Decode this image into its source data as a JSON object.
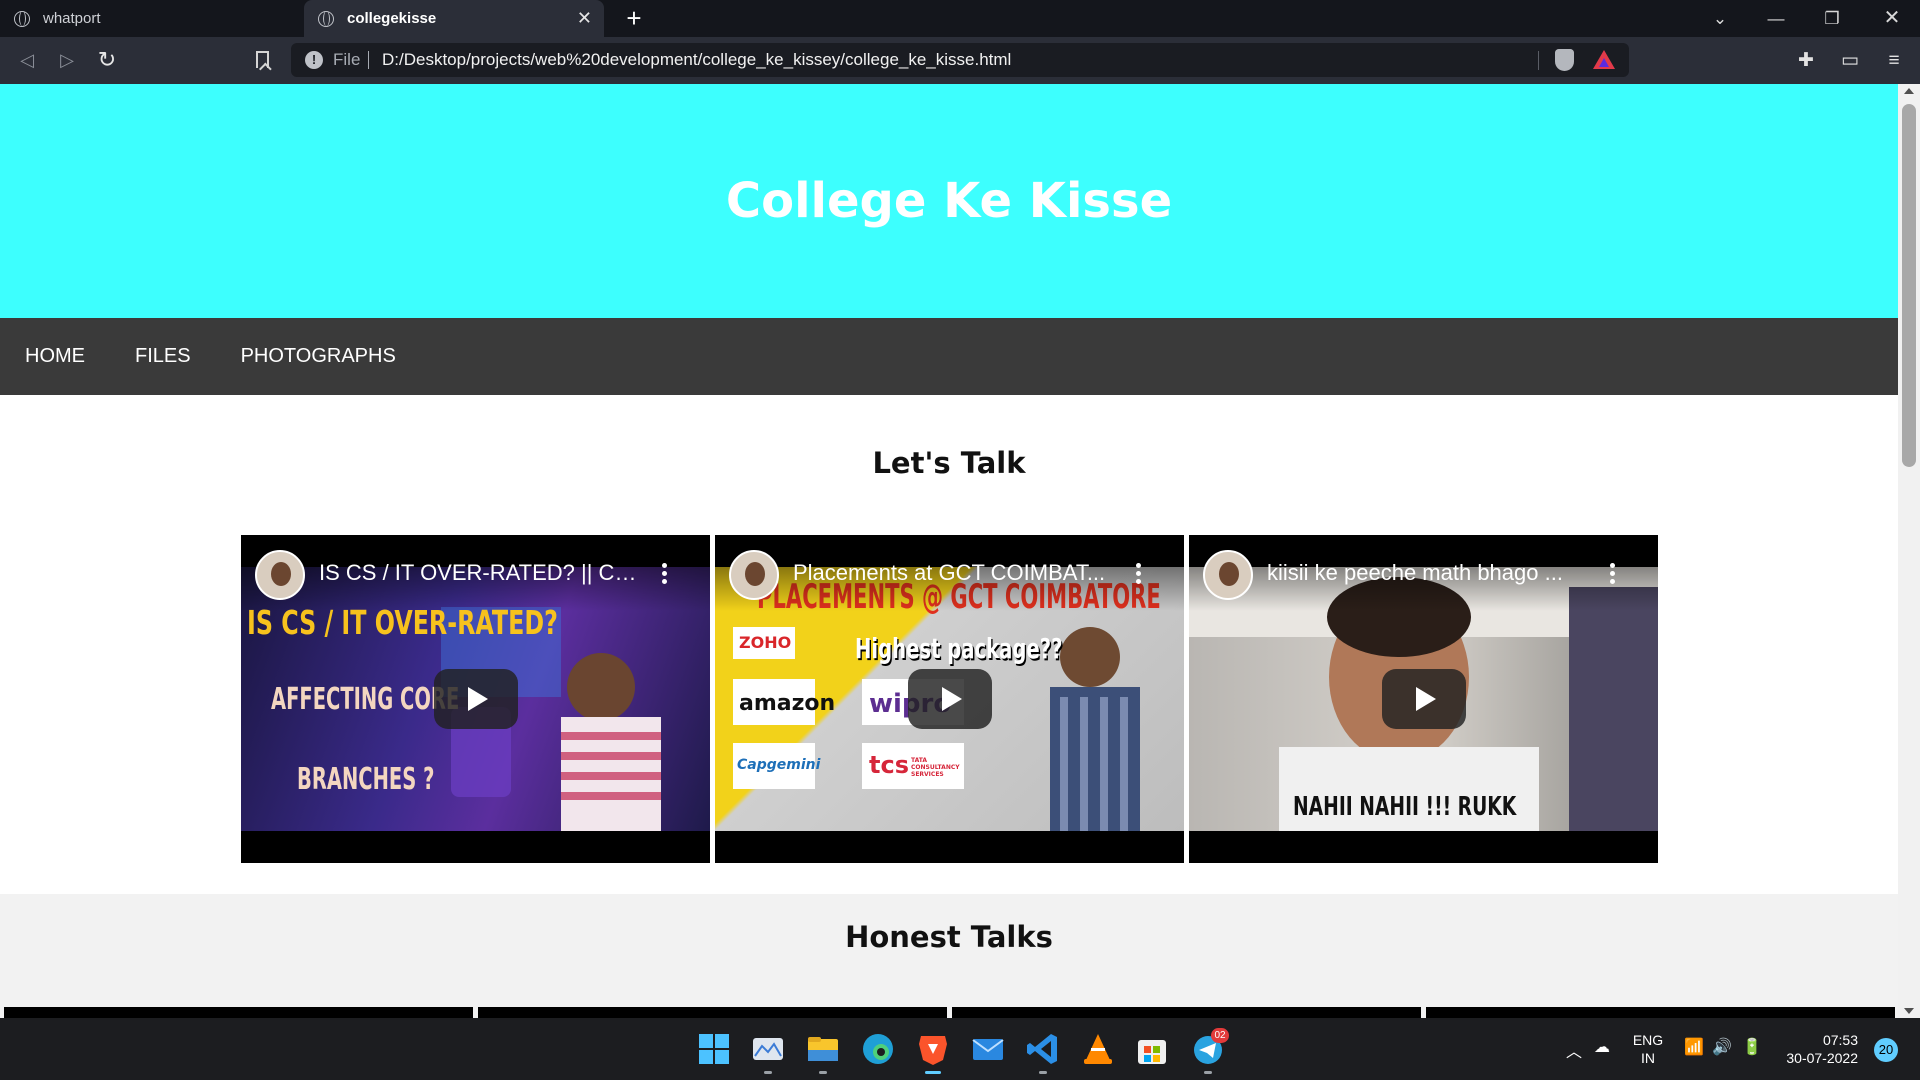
{
  "browser": {
    "tabs": [
      {
        "label": "whatport",
        "active": false
      },
      {
        "label": "collegekisse",
        "active": true
      }
    ],
    "address": {
      "scheme_label": "File",
      "url": "D:/Desktop/projects/web%20development/college_ke_kissey/college_ke_kisse.html"
    }
  },
  "page": {
    "header": {
      "title": "College Ke Kisse",
      "bg_color": "#3dfffe"
    },
    "nav": {
      "items": [
        "HOME",
        "FILES",
        "PHOTOGRAPHS"
      ],
      "bg_color": "#3a3a3a"
    },
    "lets_talk": {
      "heading": "Let's Talk",
      "videos": [
        {
          "title": "IS CS / IT OVER-RATED? || CO...",
          "thumb_text": [
            "IS CS / IT OVER-RATED?",
            "AFFECTING CORE",
            "BRANCHES ?"
          ]
        },
        {
          "title": "Placements at GCT COIMBAT...",
          "thumb_text": [
            "PLACEMENTS @ GCT COIMBATORE",
            "Highest package??",
            "ZOHO",
            "amazon",
            "wipro",
            "Capgemini",
            "tcs",
            "TATA CONSULTANCY SERVICES"
          ]
        },
        {
          "title": "kiisii ke peeche math bhago ...",
          "thumb_text": [
            "NAHII NAHII !!! RUKK"
          ]
        }
      ]
    },
    "honest_talks": {
      "heading": "Honest Talks"
    }
  },
  "taskbar": {
    "apps": [
      "start-icon",
      "photos-icon",
      "file-explorer-icon",
      "edge-icon",
      "brave-icon",
      "mail-icon",
      "vscode-icon",
      "vlc-icon",
      "store-icon",
      "telegram-icon"
    ],
    "telegram_badge": "02",
    "language": [
      "ENG",
      "IN"
    ],
    "time": "07:53",
    "date": "30-07-2022",
    "notifications": "20"
  }
}
